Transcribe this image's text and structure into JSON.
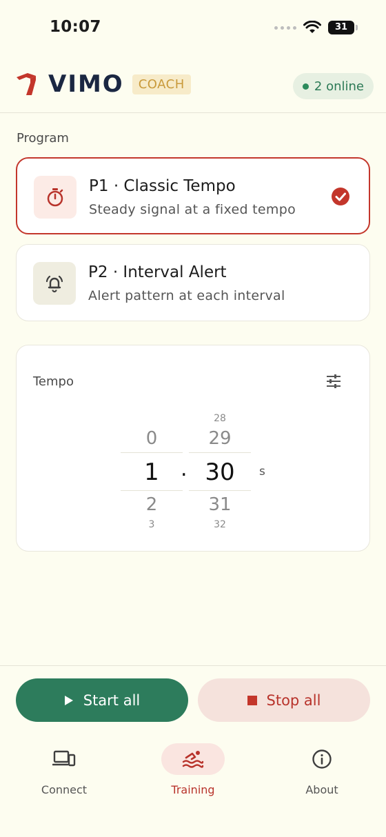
{
  "status": {
    "time": "10:07",
    "battery": "31"
  },
  "header": {
    "brand": "VIMO",
    "badge": "COACH",
    "online": "2 online"
  },
  "program": {
    "label": "Program",
    "items": [
      {
        "title": "P1 · Classic Tempo",
        "desc": "Steady signal at a fixed tempo",
        "selected": true
      },
      {
        "title": "P2 · Interval Alert",
        "desc": "Alert pattern at each interval",
        "selected": false
      }
    ]
  },
  "tempo": {
    "label": "Tempo",
    "seconds": {
      "far_above": "",
      "above": "0",
      "value": "1",
      "below": "2",
      "far_below": "3"
    },
    "hundredths": {
      "far_above": "28",
      "above": "29",
      "value": "30",
      "below": "31",
      "far_below": "32"
    },
    "separator": ".",
    "unit": "s"
  },
  "actions": {
    "start": "Start all",
    "stop": "Stop all"
  },
  "tabs": [
    {
      "label": "Connect",
      "active": false
    },
    {
      "label": "Training",
      "active": true
    },
    {
      "label": "About",
      "active": false
    }
  ],
  "colors": {
    "accent_red": "#c3362b",
    "accent_green": "#2d7c5c",
    "background": "#fdfdf0",
    "coach_gold": "#c99a3b"
  }
}
